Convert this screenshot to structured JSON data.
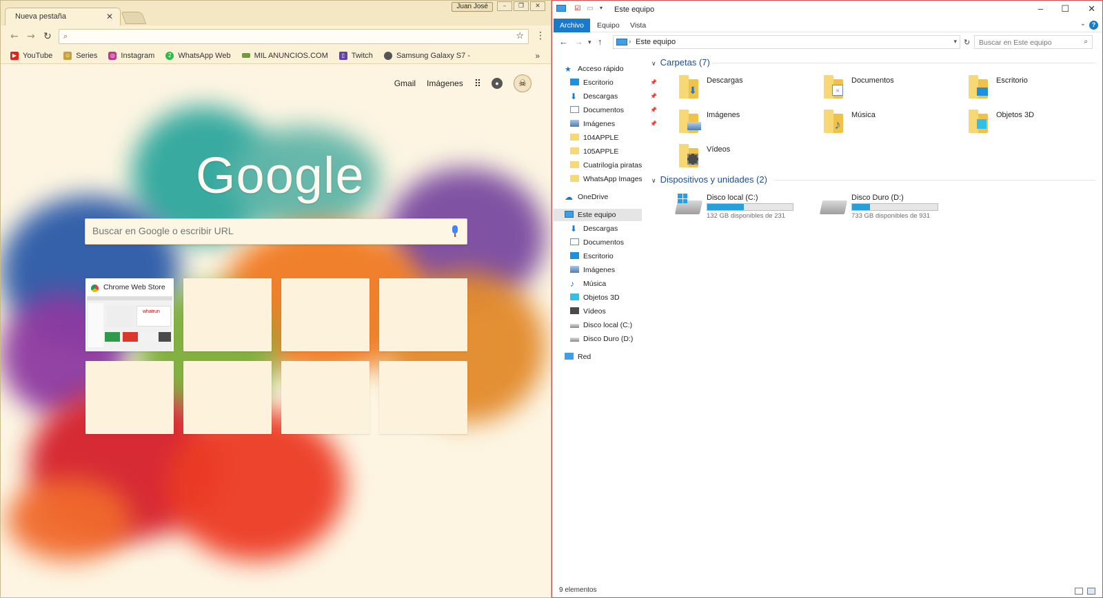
{
  "chrome": {
    "tab_title": "Nueva pestaña",
    "tab_close": "✕",
    "profile_name": "Juan José",
    "bookmarks": [
      {
        "label": "YouTube",
        "color": "#e62117"
      },
      {
        "label": "Series",
        "color": "#c7a23a"
      },
      {
        "label": "Instagram",
        "color": "#c1358c"
      },
      {
        "label": "WhatsApp Web",
        "color": "#2dba4e"
      },
      {
        "label": "MIL ANUNCIOS.COM",
        "color": "#6f9d3c"
      },
      {
        "label": "Twitch",
        "color": "#6441a4"
      },
      {
        "label": "Samsung Galaxy S7 -",
        "color": "#555555"
      }
    ],
    "bookmarks_more": "»",
    "ntp": {
      "gmail": "Gmail",
      "images": "Imágenes",
      "logo": "Google",
      "search_placeholder": "Buscar en Google o escribir URL",
      "tile_cws": "Chrome Web Store",
      "cws_brand": "whatrun"
    }
  },
  "explorer": {
    "title": "Este equipo",
    "ribbon_tabs": [
      "Archivo",
      "Equipo",
      "Vista"
    ],
    "address": "Este equipo",
    "search_placeholder": "Buscar en Este equipo",
    "nav": {
      "quick_access": "Acceso rápido",
      "quick_items": [
        {
          "label": "Escritorio",
          "pinned": true
        },
        {
          "label": "Descargas",
          "pinned": true
        },
        {
          "label": "Documentos",
          "pinned": true
        },
        {
          "label": "Imágenes",
          "pinned": true
        },
        {
          "label": "104APPLE",
          "pinned": false
        },
        {
          "label": "105APPLE",
          "pinned": false
        },
        {
          "label": "Cuatrilogía piratas I",
          "pinned": false
        },
        {
          "label": "WhatsApp Images",
          "pinned": false
        }
      ],
      "onedrive": "OneDrive",
      "this_pc": "Este equipo",
      "pc_items": [
        "Descargas",
        "Documentos",
        "Escritorio",
        "Imágenes",
        "Música",
        "Objetos 3D",
        "Vídeos",
        "Disco local (C:)",
        "Disco Duro (D:)"
      ],
      "network": "Red"
    },
    "folders_header": "Carpetas (7)",
    "folders": [
      {
        "label": "Descargas",
        "icon": "download-arrow-icon"
      },
      {
        "label": "Documentos",
        "icon": "document-icon"
      },
      {
        "label": "Escritorio",
        "icon": "desktop-icon"
      },
      {
        "label": "Imágenes",
        "icon": "picture-icon"
      },
      {
        "label": "Música",
        "icon": "music-note-icon"
      },
      {
        "label": "Objetos 3D",
        "icon": "cube-icon"
      },
      {
        "label": "Vídeos",
        "icon": "film-icon"
      }
    ],
    "devices_header": "Dispositivos y unidades (2)",
    "drives": [
      {
        "name": "Disco local (C:)",
        "free": "132 GB disponibles de 231",
        "used_fraction": 0.43
      },
      {
        "name": "Disco Duro (D:)",
        "free": "733 GB disponibles de 931",
        "used_fraction": 0.21
      }
    ],
    "status": "9 elementos"
  }
}
